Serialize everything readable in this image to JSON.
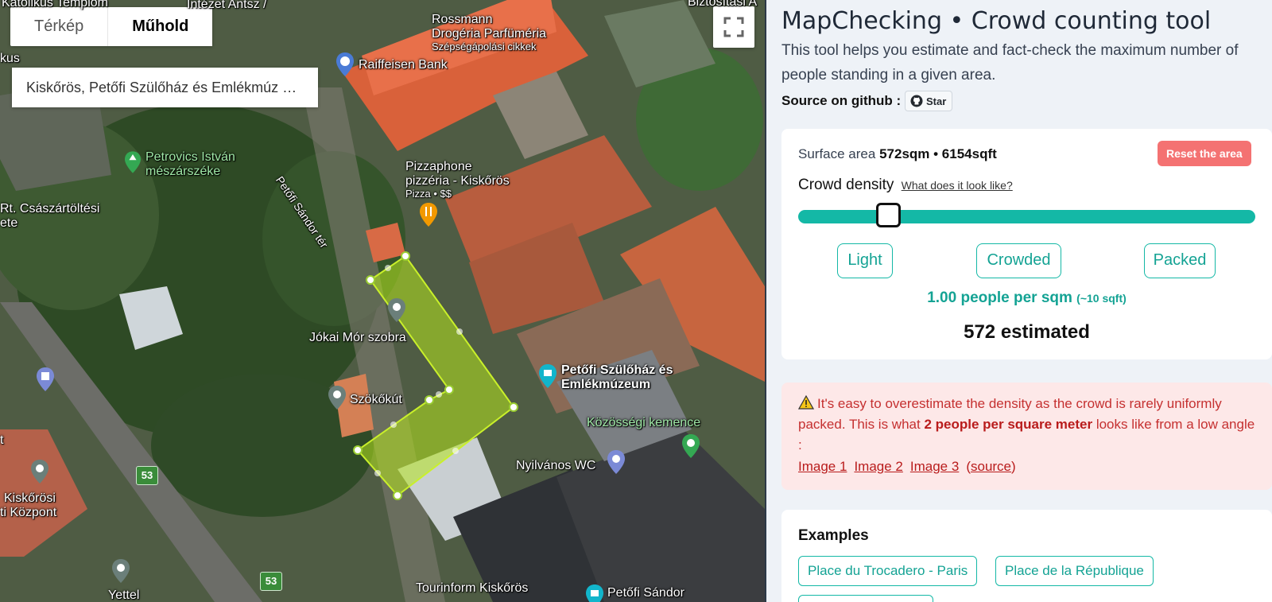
{
  "map": {
    "maptype_map": "Térkép",
    "maptype_satellite": "Műhold",
    "place_name": "Kiskőrös, Petőfi Szülőház és Emlékmúz …",
    "labels": {
      "katolikus": "Katolikus Templom",
      "intezet": "Intézet Antsz /",
      "biztositasi": "Biztosítási A",
      "kus": "kus",
      "rossmann_1": "Rossmann",
      "rossmann_2": "Drogéria Parfüméria",
      "rossmann_3": "Szépségápolási cikkek",
      "raiffeisen": "Raiffeisen Bank",
      "petrovics_1": "Petrovics István",
      "petrovics_2": "mészárszéke",
      "petofi_sandor_ter": "Petőfi Sándor tér",
      "pizzaphone_1": "Pizzaphone",
      "pizzaphone_2": "pizzéria - Kiskőrös",
      "pizzaphone_3": "Pizza • $$",
      "csaszartoltesi_1": "Rt. Császártöltési",
      "csaszartoltesi_2": "ete",
      "jokai": "Jókai Mór szobra",
      "szokokut": "Szökőkút",
      "petofi_szulohaz_1": "Petőfi Szülőház és",
      "petofi_szulohaz_2": "Emlékmúzeum",
      "kozossegi": "Közösségi kemence",
      "nyilvanos": "Nyilvános WC",
      "kiskorosi_1": "Kiskőrösi",
      "kiskorosi_2": "ti Központ",
      "yettel": "Yettel",
      "tourinform": "Tourinform Kiskőrös",
      "petofi_sandor": "Petőfi Sándor",
      "t": "t"
    },
    "road_badge_1": "53",
    "road_badge_2": "53"
  },
  "panel": {
    "title": "MapChecking • Crowd counting tool",
    "description": "This tool helps you estimate and fact-check the maximum number of people standing in a given area.",
    "source_label": "Source on github :",
    "github_button": "Star",
    "surface_prefix": "Surface area",
    "surface_value": "572sqm • 6154sqft",
    "reset_button": "Reset the area",
    "density_label": "Crowd density",
    "density_link": "What does it look like?",
    "density_slider_fraction": 0.18,
    "presets": [
      "Light",
      "Crowded",
      "Packed"
    ],
    "people_per_sqm": "1.00 people per sqm",
    "people_per_sqm_note": "(~10 sqft)",
    "estimated": "572 estimated",
    "warning": {
      "icon": "warning-icon",
      "text_1": "It's easy to overestimate the density as the crowd is rarely uniformly packed. This is what",
      "text_bold": "2 people per square meter",
      "text_2": "looks like from a low angle :",
      "links": [
        "Image 1",
        "Image 2",
        "Image 3"
      ],
      "source_link": "source",
      "source_open": "(",
      "source_close": ")"
    },
    "examples_title": "Examples",
    "examples": [
      "Place du Trocadero - Paris",
      "Place de la République"
    ]
  },
  "colors": {
    "accent": "#14b8a6",
    "reset": "#f47272",
    "warning_bg": "#fde8e8",
    "warning_text": "#c53030",
    "polygon": "#b5e61d"
  }
}
